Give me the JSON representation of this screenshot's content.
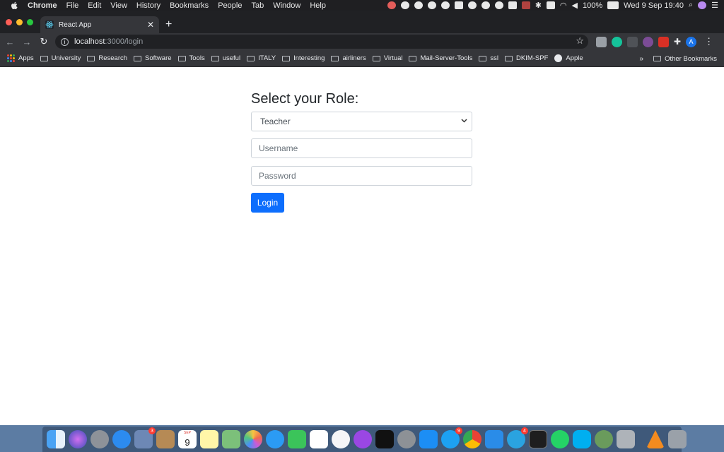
{
  "menubar": {
    "app_name": "Chrome",
    "menus": [
      "File",
      "Edit",
      "View",
      "History",
      "Bookmarks",
      "People",
      "Tab",
      "Window",
      "Help"
    ],
    "battery": "100%",
    "datetime": "Wed 9 Sep  19:40"
  },
  "browser": {
    "tab_title": "React App",
    "url_host": "localhost",
    "url_path": ":3000/login",
    "avatar_initial": "A",
    "bookmarks": [
      "University",
      "Research",
      "Software",
      "Tools",
      "useful",
      "ITALY",
      "Interesting",
      "airliners",
      "Virtual",
      "Mail-Server-Tools",
      "ssl",
      "DKIM-SPF"
    ],
    "bookmark_apps": "Apps",
    "bookmark_apple": "Apple",
    "overflow": "»",
    "other_bookmarks": "Other Bookmarks"
  },
  "login": {
    "heading": "Select your Role:",
    "role_selected": "Teacher",
    "username_placeholder": "Username",
    "password_placeholder": "Password",
    "login_label": "Login"
  },
  "dock": {
    "calendar_day": "9",
    "calendar_month": "SEP",
    "badges": {
      "app_store_sys": "3",
      "twitter": "9",
      "telegram": "4"
    }
  }
}
